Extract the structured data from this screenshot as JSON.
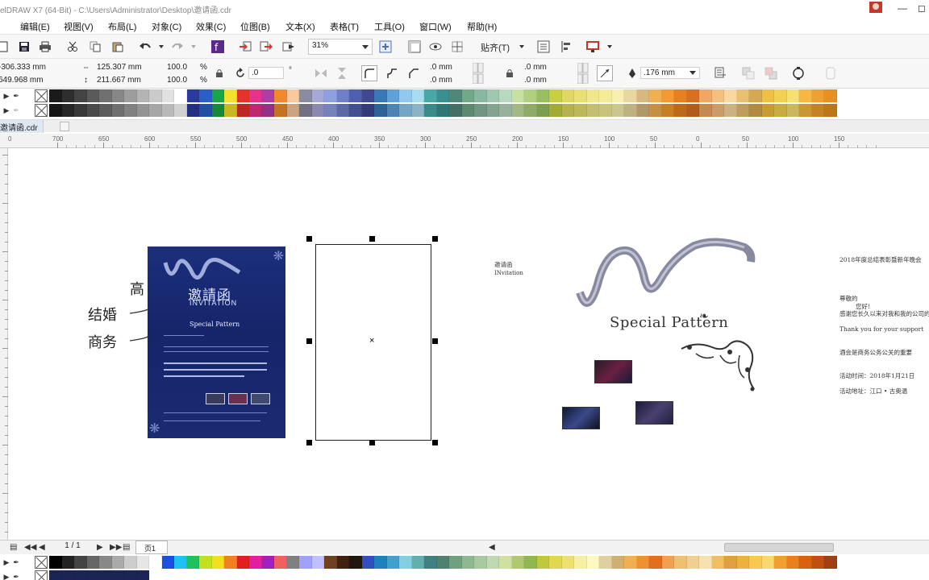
{
  "window": {
    "title": "elDRAW X7 (64-Bit) - C:\\Users\\Administrator\\Desktop\\邀请函.cdr",
    "min_icon": "minimize-icon",
    "max_icon": "maximize-icon"
  },
  "menu": [
    {
      "label": "编辑(E)"
    },
    {
      "label": "视图(V)"
    },
    {
      "label": "布局(L)"
    },
    {
      "label": "对象(C)"
    },
    {
      "label": "效果(C)"
    },
    {
      "label": "位图(B)"
    },
    {
      "label": "文本(X)"
    },
    {
      "label": "表格(T)"
    },
    {
      "label": "工具(O)"
    },
    {
      "label": "窗口(W)"
    },
    {
      "label": "帮助(H)"
    }
  ],
  "toolbar": {
    "zoom": "31%",
    "snap_label": "贴齐(T)"
  },
  "properties": {
    "x": "-306.333 mm",
    "y": "649.968 mm",
    "width": "125.307 mm",
    "height": "211.667 mm",
    "scale_x": "100.0",
    "scale_y": "100.0",
    "percent": "%",
    "rotation": ".0",
    "degree": "°",
    "corner_1": ".0 mm",
    "corner_2": ".0 mm",
    "corner_3": ".0 mm",
    "corner_4": ".0 mm",
    "outline_width": ".176 mm"
  },
  "palette_colors": [
    "#1a1a1a",
    "#2e2e2e",
    "#444444",
    "#5a5a5a",
    "#707070",
    "#878787",
    "#9d9d9d",
    "#b4b4b4",
    "#cacaca",
    "#e1e1e1",
    "#ffffff",
    "#2b3a9e",
    "#2a5fc9",
    "#19a64a",
    "#f2e22b",
    "#e8312b",
    "#e8318a",
    "#b03ca8",
    "#f28a2b",
    "#f6c9a0",
    "#8a8aa0",
    "#a8a8d8",
    "#8fa0e0",
    "#7080c8",
    "#5060b0",
    "#404890",
    "#3a78b8",
    "#60a0d8",
    "#90c8f0",
    "#a8dcf0",
    "#48a8a8",
    "#3a9090",
    "#508878",
    "#70a888",
    "#88b8a0",
    "#a0c8b0",
    "#b8d8c0",
    "#c8e0a0",
    "#b0d080",
    "#98c060",
    "#c8d040",
    "#e0d860",
    "#e8e070",
    "#f0e888",
    "#f4ec98",
    "#f8f0b0",
    "#e8d8a0",
    "#d8b880",
    "#f0b050",
    "#f49a30",
    "#e88020",
    "#d87020",
    "#f0a860",
    "#f4c080",
    "#f8d8a0",
    "#e8c070",
    "#d8a850",
    "#f0c040",
    "#f4d050",
    "#f8e070",
    "#f8b840",
    "#f0a030",
    "#e89020"
  ],
  "palette_colors_bottom": [
    "#000000",
    "#222222",
    "#444444",
    "#666666",
    "#888888",
    "#aaaaaa",
    "#cccccc",
    "#e6e6e6",
    "#ffffff",
    "#1a4fe0",
    "#20c0f0",
    "#20c060",
    "#c0e020",
    "#f0e020",
    "#f08020",
    "#e02020",
    "#e020a0",
    "#a020c0",
    "#f06060",
    "#808080",
    "#a0a0ff",
    "#c0c0ff",
    "#704020",
    "#402010",
    "#201810",
    "#3050c0",
    "#2080c0",
    "#40a0d0",
    "#80d0e0",
    "#60b0b0",
    "#408080",
    "#508070",
    "#70a080",
    "#90b890",
    "#a8c8a0",
    "#c0d8b0",
    "#d0e0a0",
    "#b0c870",
    "#90b850",
    "#c0c840",
    "#e0d850",
    "#f0e070",
    "#f8f0a0",
    "#fff8c0",
    "#e0d0a0",
    "#d0b070",
    "#f0b050",
    "#f09030",
    "#e07020",
    "#f0a050",
    "#f0c070",
    "#f0d090",
    "#f8e0b0",
    "#f0c060",
    "#e0a040",
    "#f0b040",
    "#f8c850",
    "#f8d870",
    "#f0a030",
    "#e88020",
    "#d86010",
    "#c05010",
    "#a04010"
  ],
  "document": {
    "tab_name": "邀请函.cdr",
    "page_indicator": "1 / 1",
    "page_tab": "页1"
  },
  "ruler_ticks": [
    "700",
    "650",
    "600",
    "550",
    "500",
    "450",
    "400",
    "350",
    "300",
    "250",
    "200",
    "150",
    "100",
    "50",
    "0",
    "50",
    "100",
    "150"
  ],
  "ruler_zero": "0",
  "annotations": {
    "gao": "高",
    "jiehun": "结婚",
    "shangwu": "商务"
  },
  "invite_card": {
    "title_cn": "邀請函",
    "title_en": "INVITATION",
    "subtitle": "Special Pattern"
  },
  "right_design": {
    "header_cn": "邀请函",
    "header_en": "INvitation",
    "special_pattern": "Special Pattern",
    "line1": "2018年度总结表彰暨新年晚会",
    "line2": "尊敬的",
    "line3": "您好!",
    "line4": "感谢您长久以来对我和我的公司的支持",
    "line5": "Thank you for your support",
    "line6": "酒会是商务公务公关的重要",
    "line7": "活动时间：2018年1月21日",
    "line8": "活动地址：江口 • 古奥温"
  }
}
